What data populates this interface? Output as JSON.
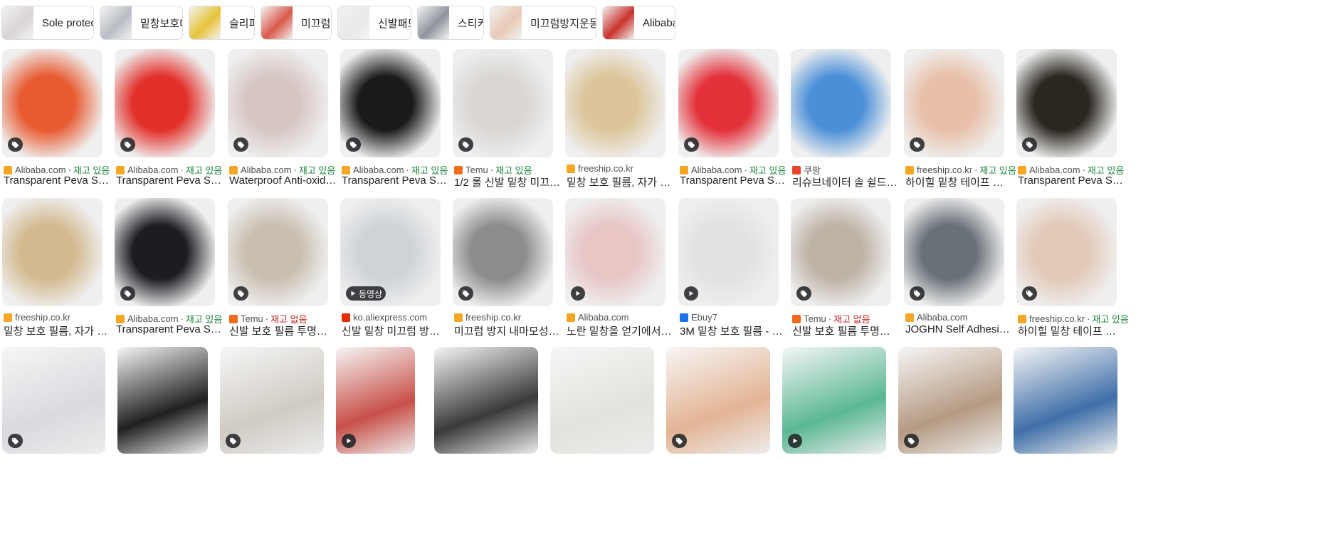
{
  "chips": [
    {
      "label": "Sole protector",
      "color": "#d9d4d6"
    },
    {
      "label": "밑창보호대",
      "color": "#b8bcc2"
    },
    {
      "label": "슬리퍼",
      "color": "#e6c33a"
    },
    {
      "label": "미끄럼",
      "color": "#d85a4a"
    },
    {
      "label": "신발패드",
      "color": "#e9e9e9"
    },
    {
      "label": "스티커",
      "color": "#8f949c"
    },
    {
      "label": "미끄럼방지운동화",
      "color": "#e8c9b4"
    },
    {
      "label": "Alibaba",
      "color": "#c9322c"
    }
  ],
  "rows": [
    [
      {
        "source": "Alibaba.com",
        "stock": "재고 있음",
        "title": "Transparent Peva Sol…",
        "badge": "tag",
        "color": "#e85a30",
        "fav": "#f5a623"
      },
      {
        "source": "Alibaba.com",
        "stock": "재고 있음",
        "title": "Transparent Peva Sol…",
        "badge": "tag",
        "color": "#e2302a",
        "fav": "#f5a623"
      },
      {
        "source": "Alibaba.com",
        "stock": "재고 있음",
        "title": "Waterproof Anti-oxidati…",
        "badge": "tag",
        "color": "#d6c6c4",
        "fav": "#f5a623"
      },
      {
        "source": "Alibaba.com",
        "stock": "재고 있음",
        "title": "Transparent Peva Sol…",
        "badge": "tag",
        "color": "#1a1a1a",
        "fav": "#f5a623"
      },
      {
        "source": "Temu",
        "stock": "재고 있음",
        "title": "1/2 롤 신발 밑창 미끄럼 …",
        "badge": "tag",
        "color": "#d9d6d3",
        "fav": "#f26b1d"
      },
      {
        "source": "freeship.co.kr",
        "stock": "",
        "title": "밑창 보호 필름, 자가 접…",
        "badge": "",
        "color": "#dcc59a",
        "fav": "#f5a623"
      },
      {
        "source": "Alibaba.com",
        "stock": "재고 있음",
        "title": "Transparent Peva Sol…",
        "badge": "tag",
        "color": "#e3313a",
        "fav": "#f5a623"
      },
      {
        "source": "쿠팡",
        "stock": "",
        "title": "리슈브네이터 솔 쉴드 아…",
        "badge": "",
        "color": "#4a8fd8",
        "fav": "#e8442c"
      },
      {
        "source": "freeship.co.kr",
        "stock": "재고 있음",
        "title": "하이힐 밑창 테이프 스티…",
        "badge": "tag",
        "color": "#e8bfa8",
        "fav": "#f5a623"
      },
      {
        "source": "Alibaba.com",
        "stock": "재고 있음",
        "title": "Transparent Peva Sol…",
        "badge": "tag",
        "color": "#2a2620",
        "fav": "#f5a623"
      }
    ],
    [
      {
        "source": "freeship.co.kr",
        "stock": "",
        "title": "밑창 보호 필름, 자가 접…",
        "badge": "",
        "color": "#d3b98f",
        "fav": "#f5a623"
      },
      {
        "source": "Alibaba.com",
        "stock": "재고 있음",
        "title": "Transparent Peva Sol…",
        "badge": "tag",
        "color": "#1c1d22",
        "fav": "#f5a623"
      },
      {
        "source": "Temu",
        "stock": "재고 없음",
        "title": "신발 보호 필름 투명한 …",
        "badge": "tag",
        "color": "#c9beb0",
        "fav": "#f26b1d"
      },
      {
        "source": "ko.aliexpress.com",
        "stock": "",
        "title": "신발 밑창 미끄럼 방지 …",
        "badge": "동영상",
        "color": "#cfd3d8",
        "fav": "#e62e04"
      },
      {
        "source": "freeship.co.kr",
        "stock": "",
        "title": "미끄럼 방지 내마모성 신…",
        "badge": "tag",
        "color": "#8c8c8c",
        "fav": "#f5a623"
      },
      {
        "source": "Alibaba.com",
        "stock": "",
        "title": "노란 밑창을 얻기에서 장…",
        "badge": "play",
        "color": "#e8c6c6",
        "fav": "#f5a623"
      },
      {
        "source": "Ebuy7",
        "stock": "",
        "title": "3M 밑창 보호 필름 - 미…",
        "badge": "play",
        "color": "#e2e2e4",
        "fav": "#1a73e8"
      },
      {
        "source": "Temu",
        "stock": "재고 없음",
        "title": "신발 보호 필름 투명한 …",
        "badge": "tag",
        "color": "#bfb3a7",
        "fav": "#f26b1d"
      },
      {
        "source": "Alibaba.com",
        "stock": "",
        "title": "JOGHN Self Adhesive …",
        "badge": "tag",
        "color": "#6a7078",
        "fav": "#f5a623"
      },
      {
        "source": "freeship.co.kr",
        "stock": "재고 있음",
        "title": "하이힐 밑창 테이프 스티…",
        "badge": "tag",
        "color": "#e2c9b8",
        "fav": "#f5a623"
      }
    ],
    [
      {
        "badge": "tag",
        "color": "#d8dade"
      },
      {
        "badge": "",
        "color": "#202020"
      },
      {
        "badge": "tag",
        "color": "#d0cbc4"
      },
      {
        "badge": "play",
        "color": "#c85048"
      },
      {
        "badge": "",
        "color": "#3a3a3a"
      },
      {
        "badge": "",
        "color": "#e4e2dc"
      },
      {
        "badge": "tag",
        "color": "#e4b494"
      },
      {
        "badge": "play",
        "color": "#5bb894"
      },
      {
        "badge": "tag",
        "color": "#b59a82"
      },
      {
        "badge": "",
        "color": "#3f6fa8"
      }
    ]
  ],
  "dot_separator": "·"
}
